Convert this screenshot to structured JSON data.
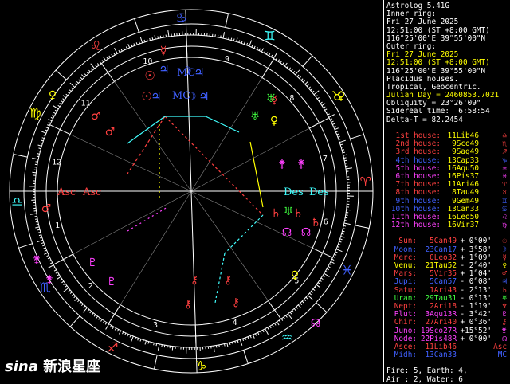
{
  "header": {
    "title": "Astrolog 5.41G",
    "inner_label": "Inner ring:",
    "inner_date": "Fri 27 June 2025",
    "inner_time": "12:51:00 (ST +8:00 GMT)",
    "inner_loc": "116°25'00\"E 39°55'00\"N",
    "outer_label": "Outer ring:",
    "outer_date": "Fri 27 June 2025",
    "outer_time": "12:51:00 (ST +8:00 GMT)",
    "outer_loc": "116°25'00\"E 39°55'00\"N",
    "houses": "Placidus houses.",
    "zodiac": "Tropical, Geocentric.",
    "julian": "Julian Day = 2460853.7021",
    "obliquity": "Obliquity = 23°26'09\"",
    "sidereal": "Sidereal time:  6:58:54",
    "delta": "Delta-T = 82.2454"
  },
  "houses": [
    {
      "label": "1st house:",
      "value": "11Lib46",
      "glyph": "♎",
      "color": "#ff4040"
    },
    {
      "label": "2nd house:",
      "value": "9Sco49",
      "glyph": "♏",
      "color": "#ff4040"
    },
    {
      "label": "3rd house:",
      "value": "9Sag49",
      "glyph": "♐",
      "color": "#ff4040"
    },
    {
      "label": "4th house:",
      "value": "13Cap33",
      "glyph": "♑",
      "color": "#4060ff"
    },
    {
      "label": "5th house:",
      "value": "16Aqu50",
      "glyph": "♒",
      "color": "#ff40ff"
    },
    {
      "label": "6th house:",
      "value": "16Pis37",
      "glyph": "♓",
      "color": "#ff40ff"
    },
    {
      "label": "7th house:",
      "value": "11Ari46",
      "glyph": "♈",
      "color": "#ff4040"
    },
    {
      "label": "8th house:",
      "value": "8Tau49",
      "glyph": "♉",
      "color": "#ff4040"
    },
    {
      "label": "9th house:",
      "value": "9Gem49",
      "glyph": "♊",
      "color": "#4060ff"
    },
    {
      "label": "10th house:",
      "value": "13Can33",
      "glyph": "♋",
      "color": "#4060ff"
    },
    {
      "label": "11th house:",
      "value": "16Leo50",
      "glyph": "♌",
      "color": "#ff40ff"
    },
    {
      "label": "12th house:",
      "value": "16Vir37",
      "glyph": "♍",
      "color": "#ff40ff"
    }
  ],
  "house_value_color": "#ffff00",
  "planets": [
    {
      "name": "Sun:",
      "pos": "5Can49",
      "lat": "+ 0°00'",
      "glyph": "☉",
      "color": "#ff4040"
    },
    {
      "name": "Moon:",
      "pos": "23Can17",
      "lat": "+ 3°58'",
      "glyph": "☽",
      "color": "#4060ff"
    },
    {
      "name": "Merc:",
      "pos": "0Leo32",
      "lat": "+ 1°09'",
      "glyph": "☿",
      "color": "#ff4040"
    },
    {
      "name": "Venu:",
      "pos": "21Tau52",
      "lat": "- 2°40'",
      "glyph": "♀",
      "color": "#ffff00"
    },
    {
      "name": "Mars:",
      "pos": "5Vir35",
      "lat": "+ 1°04'",
      "glyph": "♂",
      "color": "#ff4040"
    },
    {
      "name": "Jupi:",
      "pos": "5Can57",
      "lat": "- 0°08'",
      "glyph": "♃",
      "color": "#4060ff"
    },
    {
      "name": "Satu:",
      "pos": "1Ari43",
      "lat": "- 2°13'",
      "glyph": "♄",
      "color": "#ff4040"
    },
    {
      "name": "Uran:",
      "pos": "29Tau31",
      "lat": "- 0°13'",
      "glyph": "♅",
      "color": "#40ff40"
    },
    {
      "name": "Nept:",
      "pos": "2Ari18",
      "lat": "- 1°19'",
      "glyph": "♆",
      "color": "#ff4040"
    },
    {
      "name": "Plut:",
      "pos": "3Aqu13R",
      "lat": "- 3°42'",
      "glyph": "♇",
      "color": "#ff40ff"
    },
    {
      "name": "Chir:",
      "pos": "27Ari40",
      "lat": "+ 0°36'",
      "glyph": "⚷",
      "color": "#ff4040"
    },
    {
      "name": "Juno:",
      "pos": "19Sco27R",
      "lat": "+15°52'",
      "glyph": "⚵",
      "color": "#ff40ff"
    },
    {
      "name": "Node:",
      "pos": "22Pis48R",
      "lat": "+ 0°00'",
      "glyph": "☊",
      "color": "#ff40ff"
    },
    {
      "name": "Asce:",
      "pos": "11Lib46",
      "lat": "",
      "glyph": "Asc",
      "color": "#ff4040"
    },
    {
      "name": "Midh:",
      "pos": "13Can33",
      "lat": "",
      "glyph": "MC",
      "color": "#4060ff"
    }
  ],
  "elements": {
    "line1": "Fire: 5, Earth: 4,",
    "line2": "Air : 2, Water: 6"
  },
  "chart": {
    "signs": [
      "♈",
      "♉",
      "♊",
      "♋",
      "♌",
      "♍",
      "♎",
      "♏",
      "♐",
      "♑",
      "♒",
      "♓"
    ],
    "sign_colors": [
      "#ff4040",
      "#ffff00",
      "#40ffff",
      "#4060ff",
      "#ff4040",
      "#ffff00",
      "#40ffff",
      "#4060ff",
      "#ff4040",
      "#ffff00",
      "#40ffff",
      "#4060ff"
    ],
    "house_numbers": [
      "1",
      "2",
      "3",
      "4",
      "5",
      "6",
      "7",
      "8",
      "9",
      "10",
      "11",
      "12"
    ],
    "asc_label": "Asc",
    "des_label": "Des",
    "mc_label": "MC",
    "ic_label": "IC"
  },
  "watermark": {
    "logo": "sina",
    "text": "新浪星座"
  }
}
